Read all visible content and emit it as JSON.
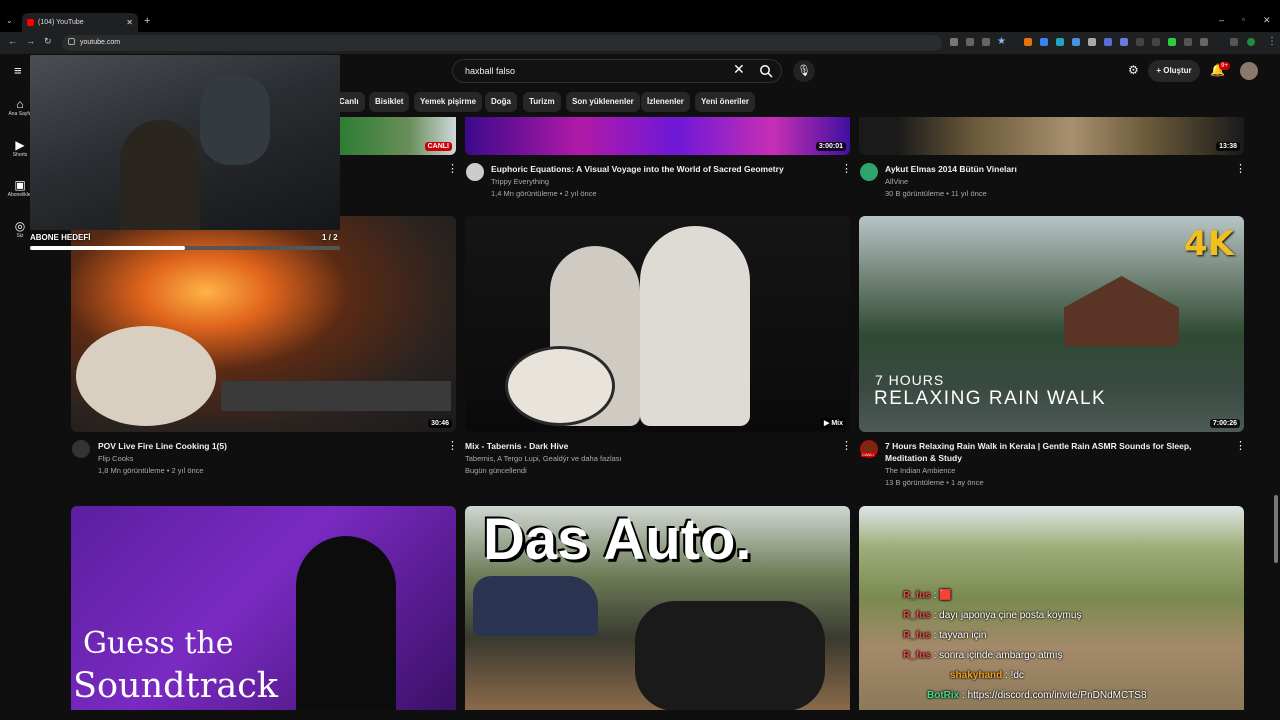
{
  "browser": {
    "tab_title": "(104) YouTube",
    "url": "youtube.com"
  },
  "youtube": {
    "search_value": "haxball falso",
    "create_label": "Oluştur",
    "notification_count": "9+",
    "sidebar": [
      {
        "label": "Ana Sayfa",
        "icon": "home-icon"
      },
      {
        "label": "Shorts",
        "icon": "shorts-icon"
      },
      {
        "label": "Abonelikler",
        "icon": "subscriptions-icon"
      },
      {
        "label": "Siz",
        "icon": "you-icon"
      }
    ],
    "categories": [
      "Canlı",
      "Bisiklet",
      "Yemek pişirme",
      "Doğa",
      "Turizm",
      "Son yüklenenler",
      "İzlenenler",
      "Yeni öneriler"
    ],
    "row1": [
      {
        "badge": "CANLI"
      },
      {
        "title": "Euphoric Equations: A Visual Voyage into the World of Sacred Geometry",
        "channel": "Trippy Everything",
        "stats": "1,4 Mn görüntüleme • 2 yıl önce",
        "duration": "3:00:01"
      },
      {
        "title": "Aykut Elmas 2014 Bütün Vineları",
        "channel": "AllVine",
        "stats": "30 B görüntüleme • 11 yıl önce",
        "duration": "13:38"
      }
    ],
    "row2": [
      {
        "title": "POV Live Fire Line Cooking 1(5)",
        "channel": "Flip Cooks",
        "stats": "1,8 Mn görüntüleme • 2 yıl önce",
        "duration": "30:46"
      },
      {
        "title": "Mix - Tabernis - Dark Hive",
        "channel": "Tabernis, A Tergo Lupi, Gealdýr ve daha fazlası",
        "stats": "Bugün güncellendi",
        "duration": "Mix"
      },
      {
        "title": "7 Hours Relaxing Rain Walk in Kerala | Gentle Rain ASMR Sounds for Sleep, Meditation & Study",
        "channel": "The Indian Ambience",
        "stats": "13 B görüntüleme • 1 ay önce",
        "duration": "7:00:26",
        "thumb_top": "4K",
        "thumb_line1": "7 HOURS",
        "thumb_line2": "RELAXING RAIN WALK",
        "live_badge": "CANLI"
      }
    ],
    "row3": [
      {
        "thumb_text1": "Guess the",
        "thumb_text2": "Soundtrack"
      },
      {
        "thumb_text": "Das Auto."
      },
      {}
    ]
  },
  "overlay": {
    "goal_label": "ABONE HEDEFİ",
    "goal_count": "1 / 2",
    "goal_progress": 0.5,
    "chat": [
      {
        "user": "R_fus",
        "text": ": 🟥"
      },
      {
        "user": "R_fus",
        "text": ": dayı japonya çine posta koymuş"
      },
      {
        "user": "R_fus",
        "text": ": tayvan için"
      },
      {
        "user": "R_fus",
        "text": ": sonra içinde ambargo atmış"
      },
      {
        "user": "shakyhand",
        "text": ": !dc"
      },
      {
        "user": "BotRix",
        "text": ": https://discord.com/invite/PnDNdMCTS8"
      }
    ]
  },
  "colors": {
    "bg": "#0f0f0f",
    "accent": "#ff0000",
    "chip": "#272727"
  }
}
